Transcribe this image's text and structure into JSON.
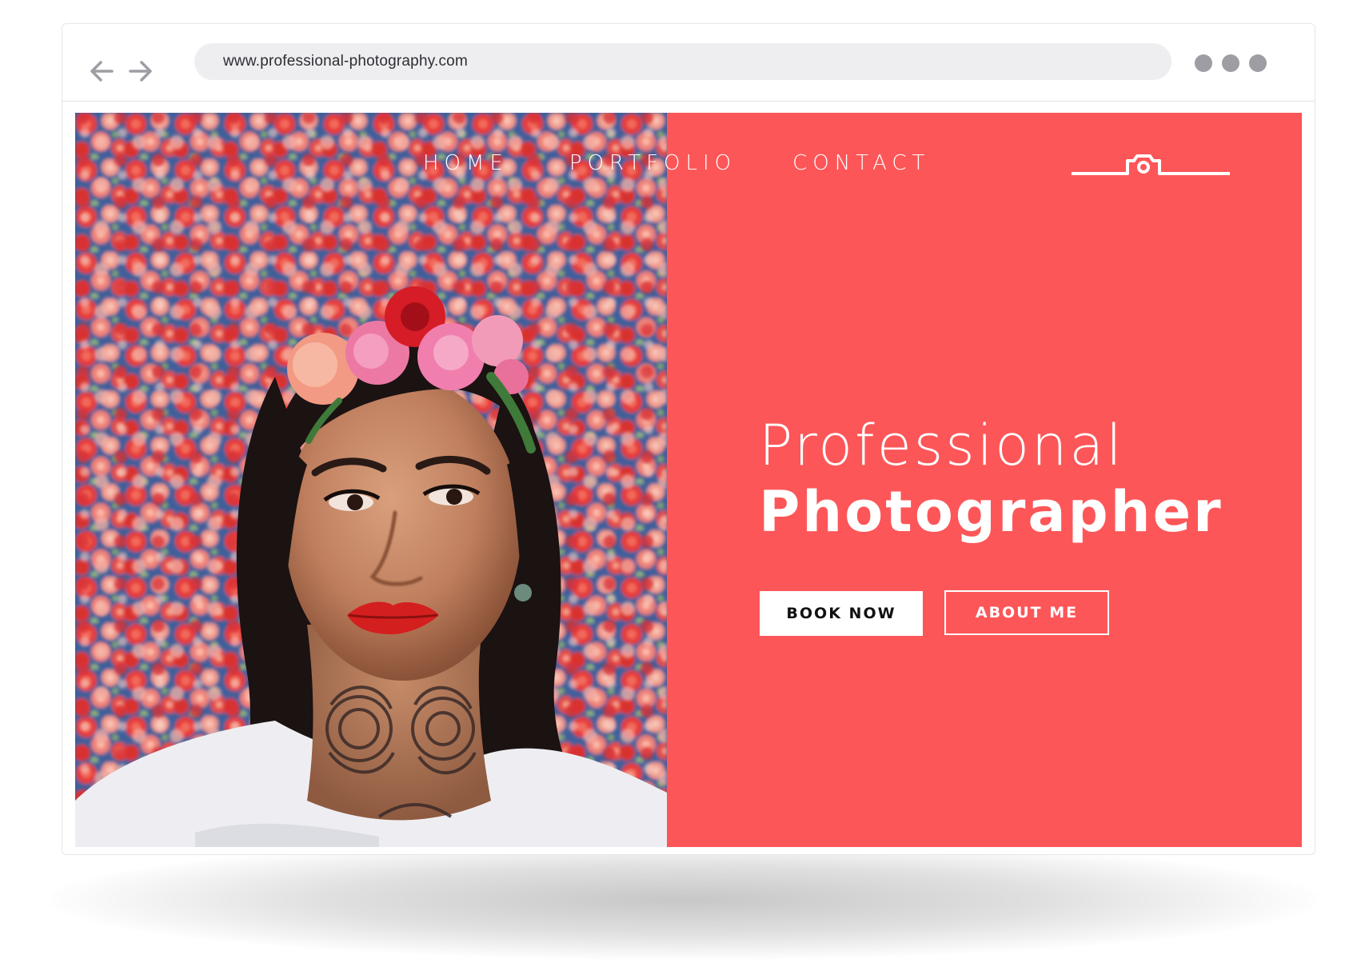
{
  "browser": {
    "url": "www.professional-photography.com",
    "back_icon": "arrow-left-icon",
    "forward_icon": "arrow-right-icon",
    "menu_icon": "three-dots-icon"
  },
  "nav": {
    "items": [
      {
        "label": "HOME"
      },
      {
        "label": "PORTFOLIO"
      },
      {
        "label": "CONTACT"
      }
    ],
    "logo_icon": "camera-icon"
  },
  "hero": {
    "line1": "Professional",
    "line2": "Photographer",
    "book_label": "BOOK NOW",
    "about_label": "ABOUT ME"
  },
  "photo": {
    "subject": "woman with flower crown in front of floral wall"
  },
  "colors": {
    "accent": "#fd5658",
    "white": "#ffffff",
    "button_text": "#111111",
    "address_bar": "#eeedf0",
    "dots": "#9d9da3"
  }
}
